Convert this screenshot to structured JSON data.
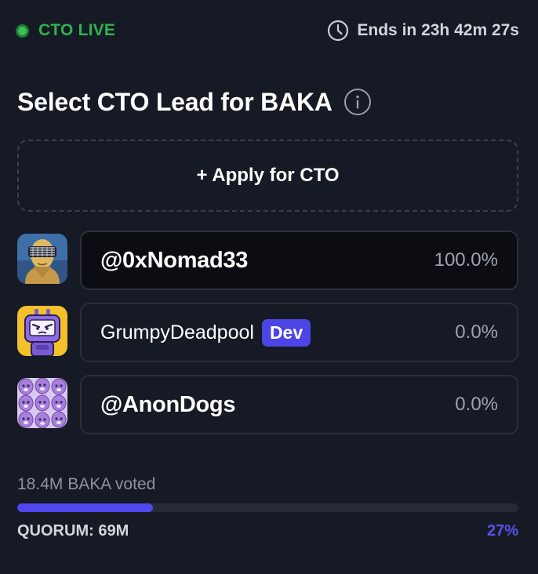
{
  "status": {
    "live_label": "CTO LIVE",
    "live_color": "#2fb44e",
    "ends_label": "Ends in 23h 42m 27s",
    "clock_icon": "clock-icon"
  },
  "header": {
    "title": "Select CTO Lead for BAKA",
    "info_icon": "info-icon"
  },
  "apply_button": {
    "label": "+ Apply for CTO"
  },
  "candidates": [
    {
      "name": "@0xNomad33",
      "percent": "100.0%",
      "selected": true,
      "badge": ""
    },
    {
      "name": "GrumpyDeadpool",
      "percent": "0.0%",
      "selected": false,
      "badge": "Dev"
    },
    {
      "name": "@AnonDogs",
      "percent": "0.0%",
      "selected": false,
      "badge": ""
    }
  ],
  "voting": {
    "voted_label": "18.4M BAKA voted",
    "progress_fraction": 0.27,
    "quorum_label": "QUORUM: 69M",
    "quorum_percent": "27%",
    "accent_color": "#5147ec"
  }
}
